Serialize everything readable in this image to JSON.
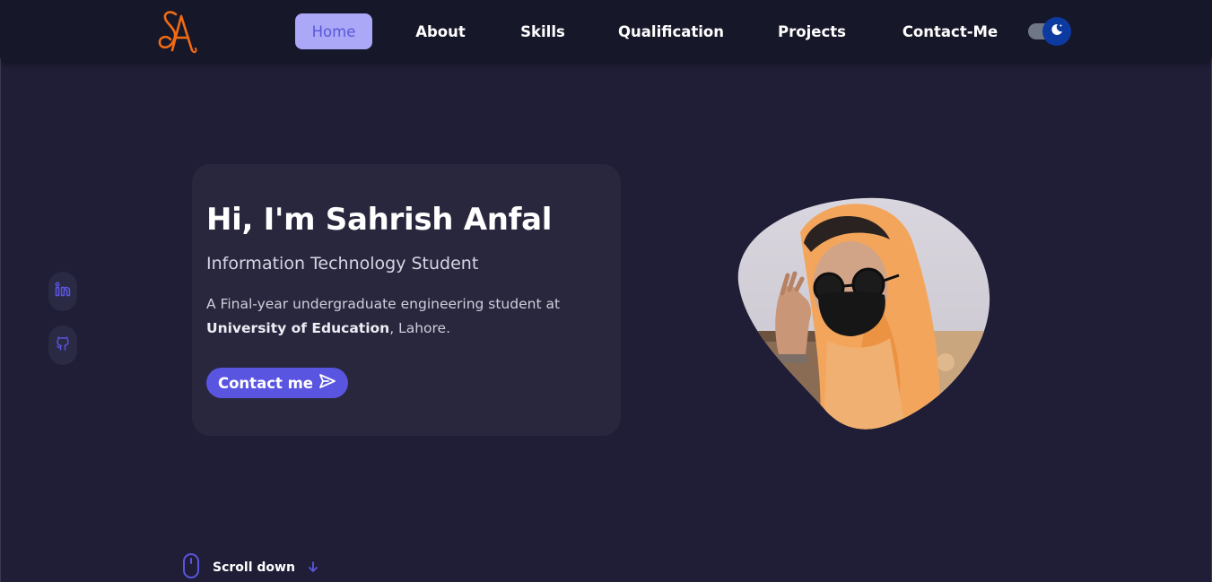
{
  "logo": {
    "text": "SA",
    "color": "#f26b12"
  },
  "nav": {
    "items": [
      {
        "label": "Home",
        "active": true
      },
      {
        "label": "About"
      },
      {
        "label": "Skills"
      },
      {
        "label": "Qualification"
      },
      {
        "label": "Projects"
      },
      {
        "label": "Contact-Me"
      }
    ],
    "theme_toggle_icon": "moon-icon"
  },
  "social": [
    {
      "icon": "linkedin-icon"
    },
    {
      "icon": "github-icon"
    }
  ],
  "hero": {
    "title": "Hi, I'm Sahrish Anfal",
    "subtitle": "Information Technology Student",
    "desc_prefix": "A Final-year undergraduate engineering student at",
    "desc_bold": "University of Education",
    "desc_suffix": ", Lahore.",
    "button_label": "Contact me",
    "button_icon": "send-icon"
  },
  "scroll": {
    "label": "Scroll down",
    "icons": [
      "mouse-icon",
      "arrow-down-icon"
    ]
  },
  "colors": {
    "background": "#1f1e36",
    "navbar": "#17172a",
    "card": "#28273d",
    "accent": "#5a55e0",
    "nav_active_bg": "#aaa8f7"
  }
}
